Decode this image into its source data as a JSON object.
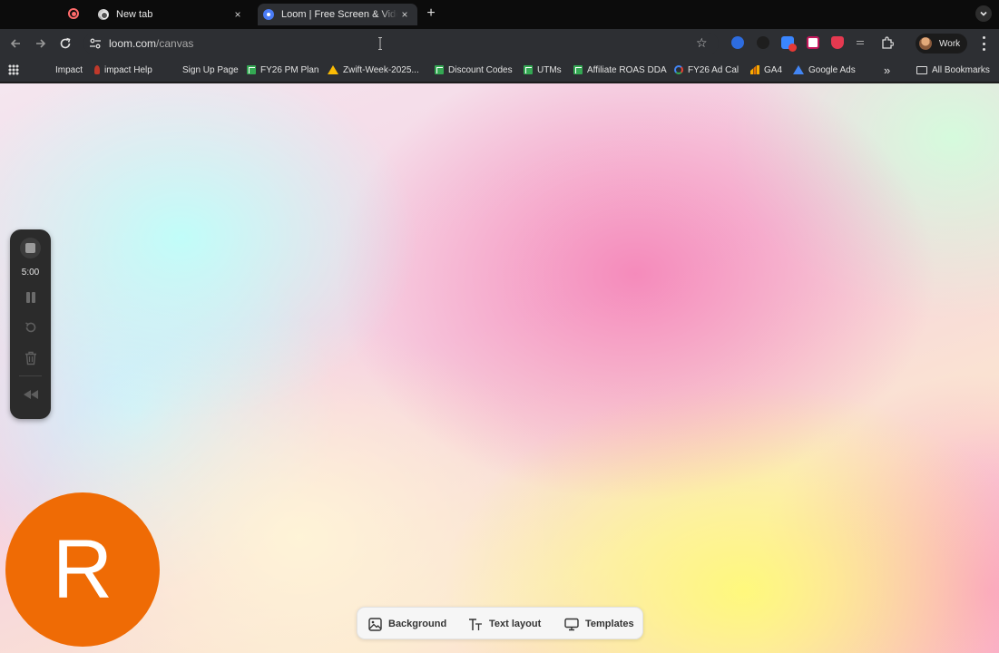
{
  "tabs": [
    {
      "title": "New tab",
      "close": "×"
    },
    {
      "title": "Loom | Free Screen & Video Recording",
      "close": "×"
    }
  ],
  "new_tab_symbol": "+",
  "address_bar": {
    "domain": "loom.com",
    "path": "/canvas"
  },
  "profile": {
    "label": "Work"
  },
  "bookmarks": [
    {
      "label": "Impact",
      "icon": "blank-icon"
    },
    {
      "label": "impact Help",
      "icon": "impact-icon"
    },
    {
      "label": "Sign Up Page",
      "icon": "blank-icon"
    },
    {
      "label": "FY26 PM Plan",
      "icon": "sheets-icon"
    },
    {
      "label": "Zwift-Week-2025...",
      "icon": "drive-icon"
    },
    {
      "label": "Discount Codes",
      "icon": "sheets-icon"
    },
    {
      "label": "UTMs",
      "icon": "sheets-icon"
    },
    {
      "label": "Affiliate ROAS DDA",
      "icon": "sheets-icon"
    },
    {
      "label": "FY26 Ad Cal",
      "icon": "google-icon"
    },
    {
      "label": "GA4",
      "icon": "analytics-icon"
    },
    {
      "label": "Google Ads",
      "icon": "google-ads-icon"
    }
  ],
  "bookmarks_overflow": "»",
  "all_bookmarks": "All Bookmarks",
  "recorder": {
    "time_remaining": "5:00"
  },
  "camera": {
    "initial": "R",
    "color": "#ef6b05"
  },
  "canvas_toolbar": {
    "background": "Background",
    "text_layout": "Text layout",
    "templates": "Templates"
  }
}
